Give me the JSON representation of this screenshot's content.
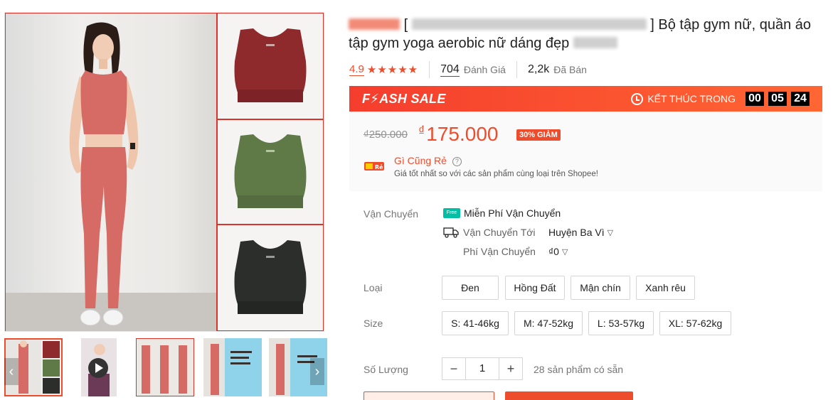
{
  "product": {
    "title": "Bộ tập gym nữ, quần áo tập gym yoga aerobic nữ dáng đẹp",
    "title_prefix_bracket_open": "[",
    "title_prefix_bracket_close": "]"
  },
  "rating": {
    "score": "4.9",
    "stars": 5,
    "reviews_count": "704",
    "reviews_label": "Đánh Giá",
    "sold_count": "2,2k",
    "sold_label": "Đã Bán"
  },
  "flash_sale": {
    "logo": "F⚡ASH SALE",
    "ends_label": "KẾT THÚC TRONG",
    "timer": [
      "00",
      "05",
      "24"
    ]
  },
  "price": {
    "original": "₫250.000",
    "currency": "₫",
    "current": "175.000",
    "discount": "30% GIẢM"
  },
  "cheap_badge": {
    "title": "Gì Cũng Rẻ",
    "description": "Giá tốt nhất so với các sản phẩm cùng loại trên Shopee!",
    "logo_text": "Rẻ"
  },
  "shipping": {
    "label": "Vận Chuyển",
    "free_badge": "Free",
    "free_text": "Miễn Phí Vận Chuyển",
    "to_label": "Vận Chuyển Tới",
    "to_value": "Huyện Ba Vì",
    "fee_label": "Phí Vận Chuyển",
    "fee_value": "₫0"
  },
  "variants": {
    "type_label": "Loại",
    "types": [
      "Đen",
      "Hồng Đất",
      "Mận chín",
      "Xanh rêu"
    ],
    "size_label": "Size",
    "sizes": [
      "S: 41-46kg",
      "M: 47-52kg",
      "L: 53-57kg",
      "XL: 57-62kg"
    ]
  },
  "quantity": {
    "label": "Số Lượng",
    "value": "1",
    "minus": "−",
    "plus": "+",
    "stock": "28 sản phẩm có sẵn"
  },
  "gallery": {
    "prev_arrow": "‹",
    "next_arrow": "›"
  },
  "colors": {
    "accent": "#ee4d2d",
    "top_red": "#8e2a2c",
    "top_green": "#5f7a47",
    "top_black": "#2b2e2a",
    "outfit_pink": "#d66a64"
  }
}
